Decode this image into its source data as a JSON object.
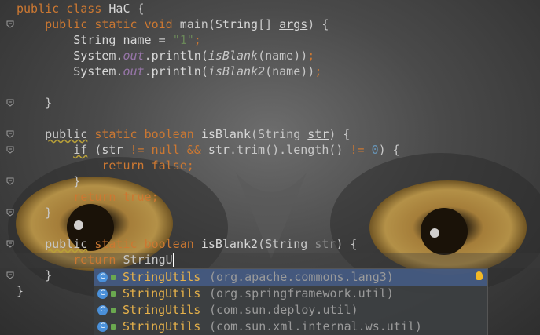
{
  "editor": {
    "lines": [
      {
        "parts": [
          [
            "kw",
            "public"
          ],
          [
            "sp",
            " "
          ],
          [
            "kw",
            "class"
          ],
          [
            "sp",
            " "
          ],
          [
            "ident",
            "HaC"
          ],
          [
            "sp",
            " {"
          ]
        ]
      },
      {
        "parts": [
          [
            "sp",
            "    "
          ],
          [
            "kw",
            "public"
          ],
          [
            "sp",
            " "
          ],
          [
            "kw",
            "static"
          ],
          [
            "sp",
            " "
          ],
          [
            "kw",
            "void"
          ],
          [
            "sp",
            " main("
          ],
          [
            "ident",
            "String"
          ],
          [
            "sp",
            "[] "
          ],
          [
            "param",
            "args"
          ],
          [
            "sp",
            ") {"
          ]
        ]
      },
      {
        "parts": [
          [
            "sp",
            "        "
          ],
          [
            "ident",
            "String"
          ],
          [
            "sp",
            " "
          ],
          [
            "ident",
            "name"
          ],
          [
            "sp",
            " = "
          ],
          [
            "str",
            "\"1\""
          ],
          [
            "semi",
            ";"
          ]
        ]
      },
      {
        "parts": [
          [
            "sp",
            "        "
          ],
          [
            "ident",
            "System."
          ],
          [
            "field",
            "out"
          ],
          [
            "sp",
            "."
          ],
          [
            "ident",
            "println("
          ],
          [
            "italic",
            "isBlank"
          ],
          [
            "sp",
            "(name))"
          ],
          [
            "semi",
            ";"
          ]
        ]
      },
      {
        "parts": [
          [
            "sp",
            "        "
          ],
          [
            "ident",
            "System."
          ],
          [
            "field",
            "out"
          ],
          [
            "sp",
            "."
          ],
          [
            "ident",
            "println("
          ],
          [
            "italic",
            "isBlank2"
          ],
          [
            "sp",
            "(name))"
          ],
          [
            "semi",
            ";"
          ]
        ]
      },
      {
        "parts": [
          [
            "sp",
            ""
          ]
        ]
      },
      {
        "parts": [
          [
            "sp",
            "    }"
          ]
        ]
      },
      {
        "parts": [
          [
            "sp",
            ""
          ]
        ]
      },
      {
        "parts": [
          [
            "sp",
            "    "
          ],
          [
            "squig",
            "public"
          ],
          [
            "sp",
            " "
          ],
          [
            "kw",
            "static"
          ],
          [
            "sp",
            " "
          ],
          [
            "kw",
            "boolean"
          ],
          [
            "sp",
            " "
          ],
          [
            "ident",
            "isBlank"
          ],
          [
            "sp",
            "(String "
          ],
          [
            "param",
            "str"
          ],
          [
            "sp",
            ") {"
          ]
        ]
      },
      {
        "parts": [
          [
            "sp",
            "        "
          ],
          [
            "squig",
            "if"
          ],
          [
            "sp",
            " ("
          ],
          [
            "param",
            "str"
          ],
          [
            "sp",
            " "
          ],
          [
            "kw",
            "!="
          ],
          [
            "sp",
            " "
          ],
          [
            "kw",
            "null"
          ],
          [
            "sp",
            " "
          ],
          [
            "kw",
            "&&"
          ],
          [
            "sp",
            " "
          ],
          [
            "param",
            "str"
          ],
          [
            "sp",
            ".trim().length() "
          ],
          [
            "kw",
            "!="
          ],
          [
            "sp",
            " "
          ],
          [
            "num",
            "0"
          ],
          [
            "sp",
            ") {"
          ]
        ]
      },
      {
        "parts": [
          [
            "sp",
            "            "
          ],
          [
            "kw",
            "return"
          ],
          [
            "sp",
            " "
          ],
          [
            "kw",
            "false"
          ],
          [
            "semi",
            ";"
          ]
        ]
      },
      {
        "parts": [
          [
            "sp",
            "        }"
          ]
        ]
      },
      {
        "parts": [
          [
            "sp",
            "        "
          ],
          [
            "kw",
            "return"
          ],
          [
            "sp",
            " "
          ],
          [
            "kw",
            "true"
          ],
          [
            "semi",
            ";"
          ]
        ]
      },
      {
        "parts": [
          [
            "sp",
            "    }"
          ]
        ]
      },
      {
        "parts": [
          [
            "sp",
            ""
          ]
        ]
      },
      {
        "parts": [
          [
            "sp",
            "    "
          ],
          [
            "squig",
            "public"
          ],
          [
            "sp",
            " "
          ],
          [
            "kw",
            "static"
          ],
          [
            "sp",
            " "
          ],
          [
            "kw",
            "boolean"
          ],
          [
            "sp",
            " "
          ],
          [
            "ident",
            "isBlank2"
          ],
          [
            "sp",
            "(String "
          ],
          [
            "unused",
            "str"
          ],
          [
            "sp",
            ") {"
          ]
        ]
      },
      {
        "parts": [
          [
            "sp",
            "        "
          ],
          [
            "kw",
            "return"
          ],
          [
            "sp",
            " StringU"
          ],
          [
            "cursor",
            ""
          ]
        ]
      },
      {
        "parts": [
          [
            "sp",
            "    }"
          ]
        ]
      },
      {
        "parts": [
          [
            "sp",
            "}"
          ]
        ]
      }
    ]
  },
  "completion": {
    "items": [
      {
        "icon": "C",
        "name": "StringUtils",
        "package": "(org.apache.commons.lang3)",
        "selected": true
      },
      {
        "icon": "C",
        "name": "StringUtils",
        "package": "(org.springframework.util)",
        "selected": false
      },
      {
        "icon": "C",
        "name": "StringUtils",
        "package": "(com.sun.deploy.util)",
        "selected": false
      },
      {
        "icon": "C",
        "name": "StringUtils",
        "package": "(com.sun.xml.internal.ws.util)",
        "selected": false
      }
    ]
  },
  "colors": {
    "keyword": "#cc7832",
    "string": "#6a8759",
    "number": "#6897bb",
    "popup_selection": "#4b6eaf",
    "completion_name": "#e6b14a"
  },
  "icons": [
    "fold-marker-icon",
    "class-icon",
    "lock-icon",
    "lightbulb-icon"
  ]
}
